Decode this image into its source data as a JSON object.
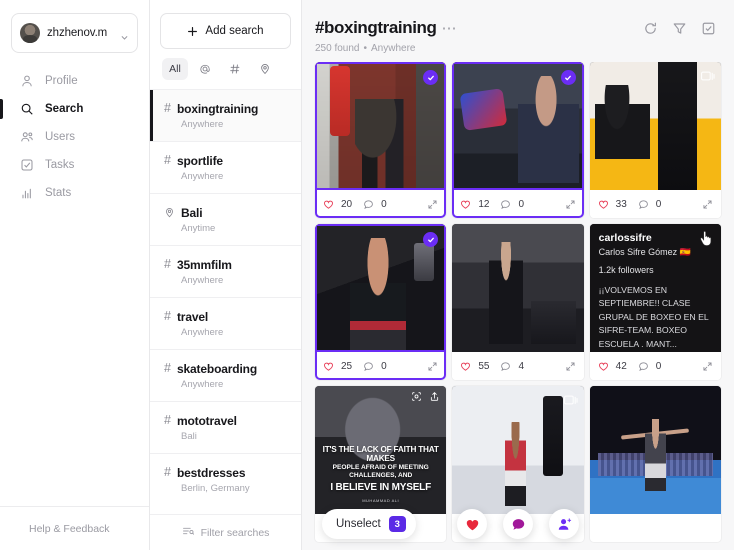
{
  "account": {
    "name": "zhzhenov.m",
    "avatar_icon": "user-avatar",
    "chevron_icon": "chevron-down-icon"
  },
  "nav": {
    "items": [
      {
        "label": "Profile",
        "icon": "person-icon",
        "active": false
      },
      {
        "label": "Search",
        "icon": "search-icon",
        "active": true
      },
      {
        "label": "Users",
        "icon": "users-icon",
        "active": false
      },
      {
        "label": "Tasks",
        "icon": "checkbox-task-icon",
        "active": false
      },
      {
        "label": "Stats",
        "icon": "bar-chart-icon",
        "active": false
      }
    ],
    "help": {
      "label": "Help & Feedback",
      "icon": "question-circle-icon"
    }
  },
  "search_panel": {
    "add_search_label": "Add search",
    "add_search_icon": "plus-icon",
    "filters": [
      {
        "label": "All",
        "icon": "",
        "active": true
      },
      {
        "label": "",
        "icon": "at-icon",
        "active": false
      },
      {
        "label": "",
        "icon": "hash-icon",
        "active": false
      },
      {
        "label": "",
        "icon": "location-pin-icon",
        "active": false
      }
    ],
    "saved_searches": [
      {
        "symbol": "#",
        "name": "boxingtraining",
        "scope": "Anywhere",
        "selected": true
      },
      {
        "symbol": "#",
        "name": "sportlife",
        "scope": "Anywhere",
        "selected": false
      },
      {
        "symbol": "pin",
        "name": "Bali",
        "scope": "Anytime",
        "selected": false
      },
      {
        "symbol": "#",
        "name": "35mmfilm",
        "scope": "Anywhere",
        "selected": false
      },
      {
        "symbol": "#",
        "name": "travel",
        "scope": "Anywhere",
        "selected": false
      },
      {
        "symbol": "#",
        "name": "skateboarding",
        "scope": "Anywhere",
        "selected": false
      },
      {
        "symbol": "#",
        "name": "mototravel",
        "scope": "Bali",
        "selected": false
      },
      {
        "symbol": "#",
        "name": "bestdresses",
        "scope": "Berlin, Germany",
        "selected": false
      }
    ],
    "filter_searches_label": "Filter searches",
    "filter_searches_icon": "filter-list-icon"
  },
  "header": {
    "title": "#boxingtraining",
    "more_icon": "ellipsis-icon",
    "found_count": "250 found",
    "separator": "•",
    "scope": "Anywhere",
    "actions": [
      {
        "name": "refresh-icon"
      },
      {
        "name": "filter-funnel-icon"
      },
      {
        "name": "select-all-icon"
      }
    ]
  },
  "posts": [
    {
      "likes": "20",
      "comments": "0",
      "selected": true,
      "badge": "check",
      "scene": "p1"
    },
    {
      "likes": "12",
      "comments": "0",
      "selected": true,
      "badge": "check",
      "scene": "p2"
    },
    {
      "likes": "33",
      "comments": "0",
      "selected": false,
      "badge": "carousel",
      "scene": "p3"
    },
    {
      "likes": "25",
      "comments": "0",
      "selected": true,
      "badge": "check",
      "scene": "p4"
    },
    {
      "likes": "55",
      "comments": "4",
      "selected": false,
      "badge": "none",
      "scene": "p5"
    },
    {
      "likes": "42",
      "comments": "0",
      "selected": false,
      "badge": "none",
      "scene": "p6",
      "overlay": {
        "username": "carlossifre",
        "fullname": "Carlos Sifre Gómez 🇪🇸",
        "followers": "1.2k followers",
        "caption": "¡¡VOLVEMOS EN SEPTIEMBRE!! CLASE GRUPAL DE BOXEO EN EL SIFRE-TEAM. BOXEO ESCUELA . MANT..."
      }
    },
    {
      "likes": "",
      "comments": "",
      "selected": false,
      "badge": "tools",
      "scene": "p7",
      "quote": {
        "line1": "IT'S THE LACK OF FAITH THAT MAKES",
        "line2": "PEOPLE AFRAID OF MEETING CHALLENGES, AND",
        "line3": "I BELIEVE IN MYSELF",
        "line4": "MUHAMMAD ALI"
      }
    },
    {
      "likes": "",
      "comments": "",
      "selected": false,
      "badge": "carousel",
      "scene": "p8"
    },
    {
      "likes": "",
      "comments": "",
      "selected": false,
      "badge": "none",
      "scene": "p9"
    }
  ],
  "bottom_bar": {
    "unselect_label": "Unselect",
    "unselect_count": "3",
    "actions": [
      {
        "name": "like-heart-icon",
        "color": "#e8283c"
      },
      {
        "name": "comment-bubble-icon",
        "color": "#a1189a"
      },
      {
        "name": "follow-user-icon",
        "color": "#6b2df5"
      }
    ]
  },
  "colors": {
    "accent": "#6b2df5",
    "badge": "#5b2ae6",
    "heart": "#e8415a"
  }
}
